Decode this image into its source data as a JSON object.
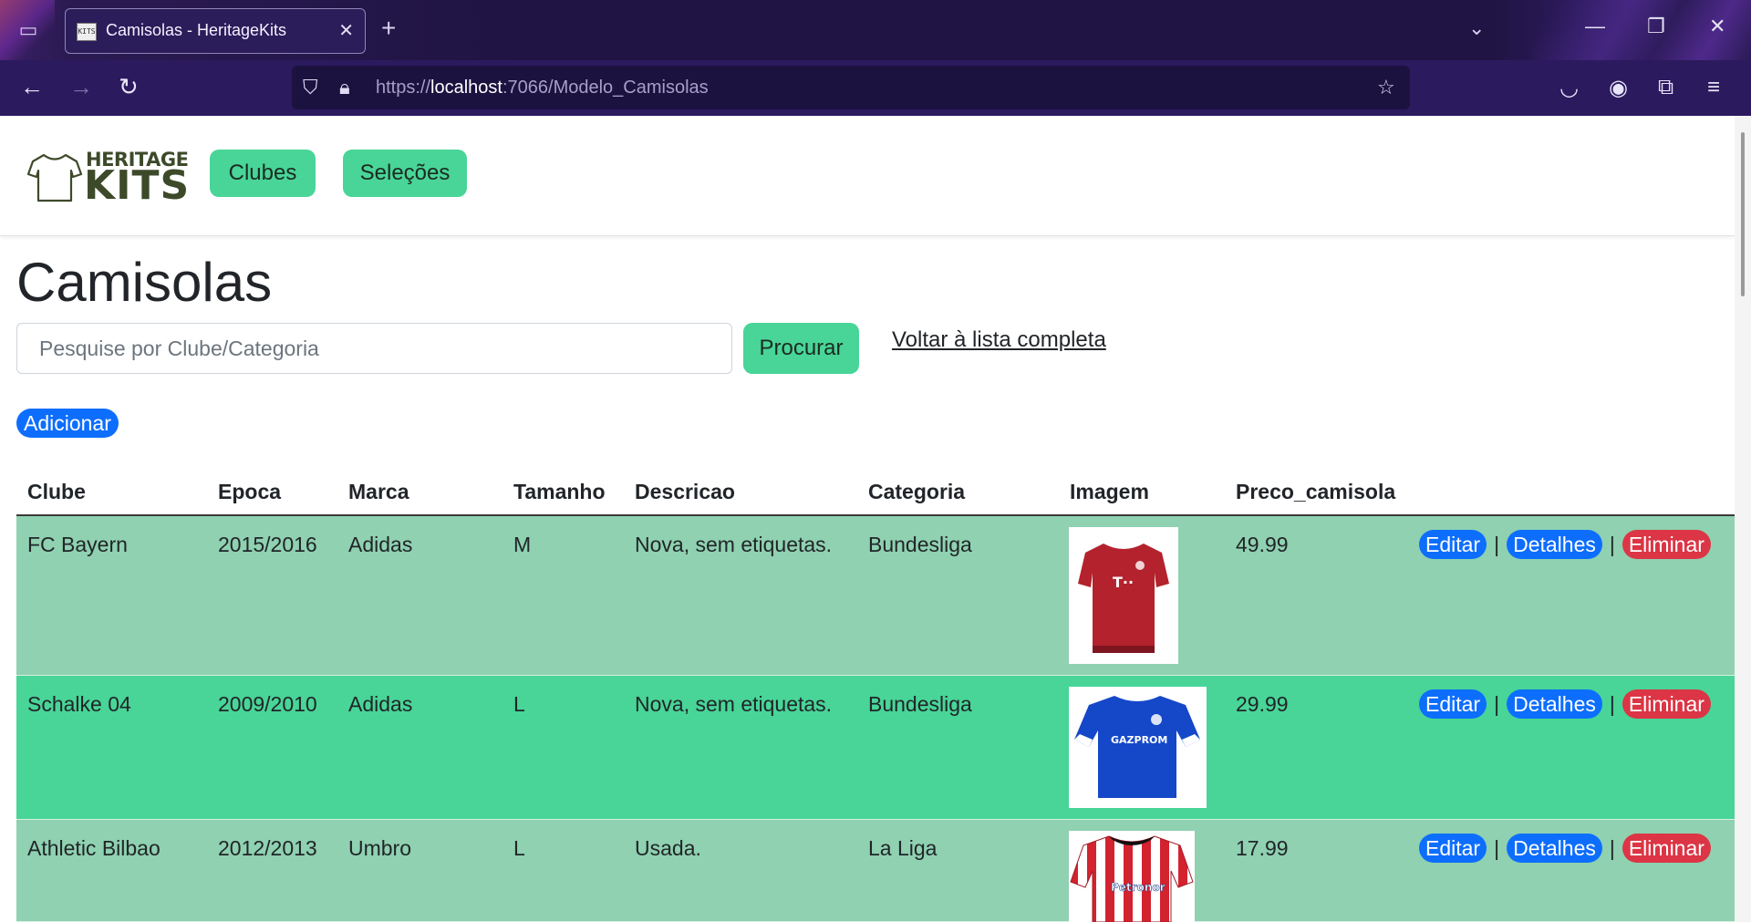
{
  "browser": {
    "tab_title": "Camisolas - HeritageKits",
    "favicon_text": "KITS",
    "url_scheme": "https://",
    "url_host": "localhost",
    "url_rest": ":7066/Modelo_Camisolas"
  },
  "site": {
    "logo": {
      "heritage": "HERITAGE",
      "kits": "KITS"
    },
    "nav": [
      {
        "label": "Clubes"
      },
      {
        "label": "Seleções"
      }
    ]
  },
  "page": {
    "title": "Camisolas",
    "search": {
      "placeholder": "Pesquise por Clube/Categoria",
      "value": ""
    },
    "search_button": "Procurar",
    "back_link": "Voltar à lista completa",
    "add_button": "Adicionar"
  },
  "table": {
    "headers": [
      "Clube",
      "Epoca",
      "Marca",
      "Tamanho",
      "Descricao",
      "Categoria",
      "Imagem",
      "Preco_camisola"
    ],
    "actions": {
      "edit": "Editar",
      "details": "Detalhes",
      "delete": "Eliminar",
      "separator": "|"
    },
    "rows": [
      {
        "clube": "FC Bayern",
        "epoca": "2015/2016",
        "marca": "Adidas",
        "tamanho": "M",
        "descricao": "Nova, sem etiquetas.",
        "categoria": "Bundesliga",
        "imagem": "bayern-red-shirt",
        "preco": "49.99"
      },
      {
        "clube": "Schalke 04",
        "epoca": "2009/2010",
        "marca": "Adidas",
        "tamanho": "L",
        "descricao": "Nova, sem etiquetas.",
        "categoria": "Bundesliga",
        "imagem": "schalke-blue-shirt",
        "preco": "29.99"
      },
      {
        "clube": "Athletic Bilbao",
        "epoca": "2012/2013",
        "marca": "Umbro",
        "tamanho": "L",
        "descricao": "Usada.",
        "categoria": "La Liga",
        "imagem": "bilbao-striped-shirt",
        "preco": "17.99"
      }
    ]
  },
  "colors": {
    "accent_green": "#48d597",
    "row_light": "#8fd1b0",
    "primary_blue": "#0d6efd",
    "danger_red": "#dc3545",
    "browser_purple": "#2b1a5e"
  }
}
